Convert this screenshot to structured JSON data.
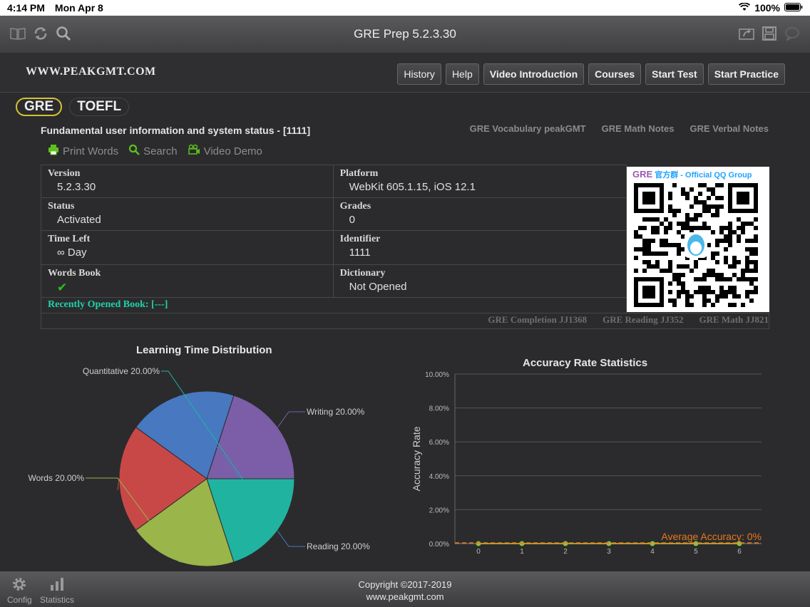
{
  "status_bar": {
    "time": "4:14 PM",
    "date": "Mon Apr 8",
    "battery": "100%"
  },
  "titlebar": {
    "title": "GRE Prep 5.2.3.30"
  },
  "header": {
    "logo": "WWW.PEAKGMT.COM",
    "nav": [
      "History",
      "Help",
      "Video Introduction",
      "Courses",
      "Start Test",
      "Start Practice"
    ]
  },
  "exam_tabs": [
    "GRE",
    "TOEFL"
  ],
  "section": {
    "title": "Fundamental user information and system status - [1111]",
    "note_links": [
      "GRE Vocabulary peakGMT",
      "GRE Math Notes",
      "GRE Verbal Notes"
    ],
    "actions": [
      "Print Words",
      "Search",
      "Video Demo"
    ]
  },
  "info": {
    "version_label": "Version",
    "version": "5.2.3.30",
    "platform_label": "Platform",
    "platform": "WebKit 605.1.15, iOS 12.1",
    "status_label": "Status",
    "status": "Activated",
    "grades_label": "Grades",
    "grades": "0",
    "time_left_label": "Time Left",
    "time_left_symbol": "∞",
    "time_left": "Day",
    "identifier_label": "Identifier",
    "identifier": "1111",
    "words_book_label": "Words Book",
    "words_book_mark": "✔",
    "dictionary_label": "Dictionary",
    "dictionary": "Not Opened",
    "recent_book": "Recently Opened Book: [---]"
  },
  "books": [
    "GRE Completion JJ1368",
    "GRE Reading JJ352",
    "GRE Math JJ821"
  ],
  "qr": {
    "gre": "GRE",
    "title": "官方群 - Official QQ Group"
  },
  "pie_chart": {
    "title": "Learning Time Distribution",
    "chart_data": {
      "type": "pie",
      "title": "Learning Time Distribution",
      "slices": [
        {
          "label": "Writing",
          "value": 20.0,
          "text": "Writing 20.00%",
          "color": "#7b5ea7"
        },
        {
          "label": "Reading",
          "value": 20.0,
          "text": "Reading 20.00%",
          "color": "#4778c0"
        },
        {
          "label": "",
          "value": 20.0,
          "text": "",
          "color": "#c84848"
        },
        {
          "label": "Words",
          "value": 20.0,
          "text": "Words 20.00%",
          "color": "#9ab54a"
        },
        {
          "label": "Quantitative",
          "value": 20.0,
          "text": "Quantitative 20.00%",
          "color": "#20b3a0"
        }
      ]
    }
  },
  "line_chart": {
    "chart_data": {
      "type": "line",
      "title": "Accuracy Rate Statistics",
      "ylabel": "Accuracy Rate",
      "x": [
        0,
        1,
        2,
        3,
        4,
        5,
        6
      ],
      "y": [
        0,
        0,
        0,
        0,
        0,
        0,
        0
      ],
      "ylim": [
        0,
        10
      ],
      "yticks": [
        "0.00%",
        "2.00%",
        "4.00%",
        "6.00%",
        "8.00%",
        "10.00%"
      ],
      "annotation": "Average Accuracy: 0%",
      "color": "#d4c232",
      "annotation_color": "#e8781e"
    }
  },
  "footer": {
    "copyright": "Copyright ©2017-2019",
    "site": "www.peakgmt.com",
    "config": "Config",
    "statistics": "Statistics"
  }
}
